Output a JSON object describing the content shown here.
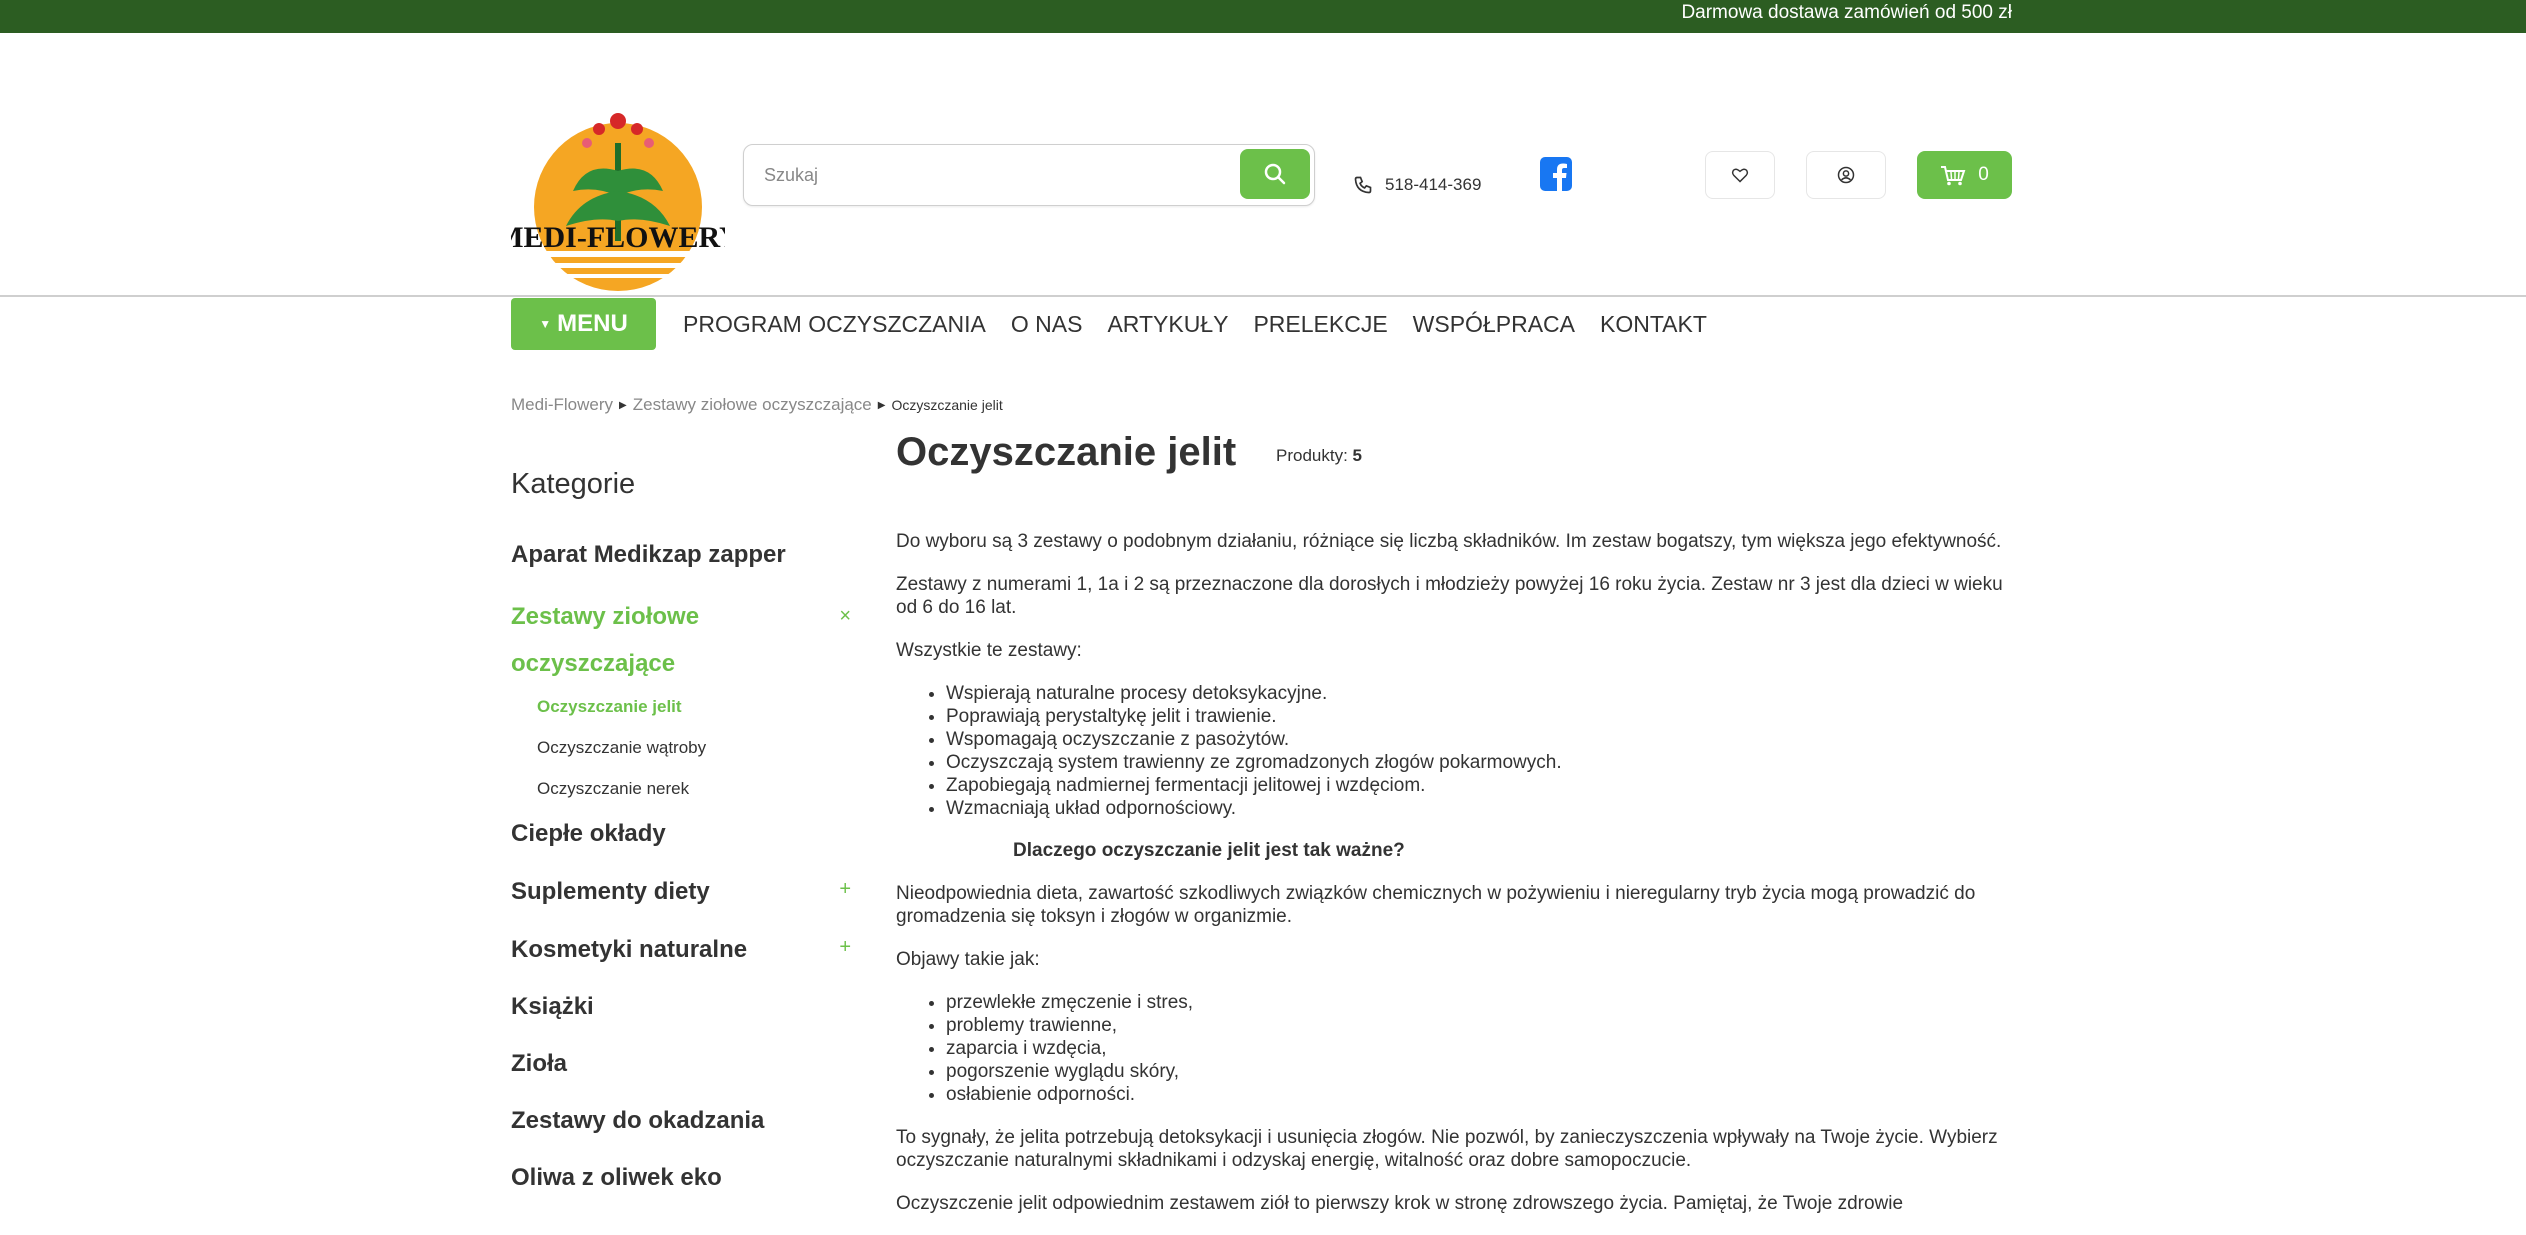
{
  "topbar": {
    "promo": "Darmowa dostawa zamówień od 500 zł"
  },
  "brand": {
    "name": "MEDI-FLOWERY",
    "accent": "#6cc04a",
    "dark_green": "#2c5d22"
  },
  "search": {
    "placeholder": "Szukaj",
    "value": ""
  },
  "contact": {
    "phone": "518-414-369"
  },
  "cart": {
    "count": "0"
  },
  "icons": [
    "search-icon",
    "phone-icon",
    "facebook-icon",
    "heart-icon",
    "user-icon",
    "basket-icon"
  ],
  "nav": {
    "menu_label": "MENU",
    "links": [
      "PROGRAM OCZYSZCZANIA",
      "O NAS",
      "ARTYKUŁY",
      "PRELEKCJE",
      "WSPÓŁPRACA",
      "KONTAKT"
    ]
  },
  "breadcrumb": [
    "Medi-Flowery",
    "Zestawy ziołowe oczyszczające",
    "Oczyszczanie jelit"
  ],
  "sidebar": {
    "title": "Kategorie",
    "categories": [
      {
        "label": "Aparat Medikzap zapper",
        "toggle": ""
      },
      {
        "label_line1": "Zestawy ziołowe",
        "label_line2": "oczyszczające",
        "toggle": "×"
      },
      {
        "label": "Ciepłe okłady",
        "toggle": ""
      },
      {
        "label": "Suplementy diety",
        "toggle": "+"
      },
      {
        "label": "Kosmetyki naturalne",
        "toggle": "+"
      },
      {
        "label": "Książki",
        "toggle": ""
      },
      {
        "label": "Zioła",
        "toggle": ""
      },
      {
        "label": "Zestawy do okadzania",
        "toggle": ""
      },
      {
        "label": "Oliwa z oliwek eko",
        "toggle": ""
      }
    ],
    "subcategories": [
      "Oczyszczanie jelit",
      "Oczyszczanie wątroby",
      "Oczyszczanie nerek"
    ]
  },
  "content": {
    "title": "Oczyszczanie jelit",
    "count_label": "Produkty:",
    "count_value": "5",
    "p1": "Do wyboru są 3 zestawy o podobnym działaniu, różniące się liczbą składników. Im zestaw bogatszy, tym większa jego efektywność.",
    "p2": "Zestawy z numerami 1, 1a i 2 są przeznaczone dla dorosłych i młodzieży powyżej 16 roku życia. Zestaw nr 3 jest dla dzieci w wieku od 6 do 16 lat.",
    "p3": "Wszystkie te zestawy:",
    "list1": [
      "Wspierają naturalne procesy detoksykacyjne.",
      "Poprawiają perystaltykę jelit i trawienie.",
      "Wspomagają oczyszczanie z pasożytów.",
      "Oczyszczają system trawienny ze zgromadzonych złogów pokarmowych.",
      "Zapobiegają nadmiernej fermentacji jelitowej i wzdęciom.",
      "Wzmacniają układ odpornościowy."
    ],
    "heading": "Dlaczego oczyszczanie jelit jest tak ważne?",
    "p4": "Nieodpowiednia dieta, zawartość szkodliwych związków chemicznych w pożywieniu i nieregularny tryb życia mogą prowadzić do gromadzenia się toksyn i złogów w organizmie.",
    "p5": "Objawy takie jak:",
    "list2": [
      "przewlekłe zmęczenie i stres,",
      "problemy trawienne,",
      "zaparcia i wzdęcia,",
      "pogorszenie wyglądu skóry,",
      "osłabienie odporności."
    ],
    "p6": "To sygnały, że jelita potrzebują detoksykacji i usunięcia złogów. Nie pozwól, by zanieczyszczenia wpływały na Twoje życie. Wybierz oczyszczanie naturalnymi składnikami i odzyskaj energię, witalność oraz dobre samopoczucie.",
    "p7": "Oczyszczenie jelit odpowiednim zestawem ziół to pierwszy krok w stronę zdrowszego życia. Pamiętaj, że Twoje zdrowie"
  }
}
